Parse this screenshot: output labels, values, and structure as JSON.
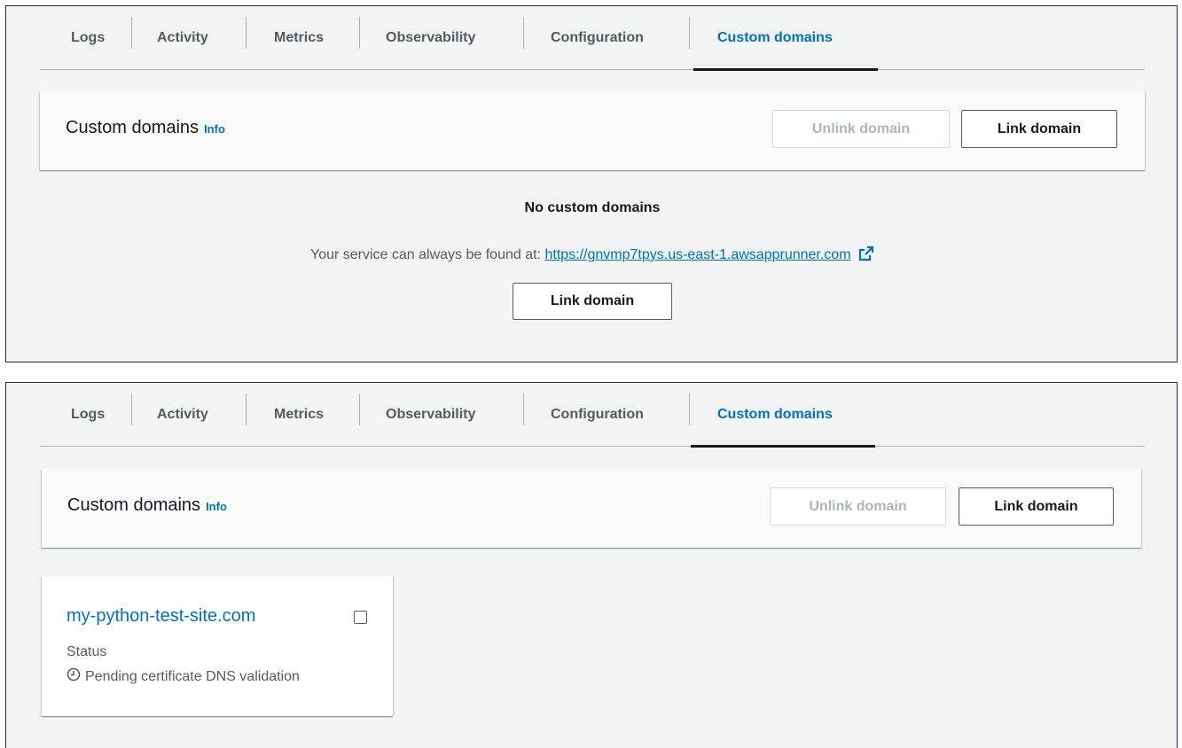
{
  "tabs": [
    "Logs",
    "Activity",
    "Metrics",
    "Observability",
    "Configuration",
    "Custom domains"
  ],
  "active_tab": "Custom domains",
  "header": {
    "title": "Custom domains",
    "info": "Info",
    "unlink_label": "Unlink domain",
    "link_label": "Link domain"
  },
  "empty_state": {
    "title": "No custom domains",
    "description": "Your service can always be found at:",
    "url": "https://gnvmp7tpys.us-east-1.awsapprunner.com",
    "link_label": "Link domain"
  },
  "domain": {
    "name": "my-python-test-site.com",
    "status_label": "Status",
    "status_value": "Pending certificate DNS validation",
    "status_icon": "clock-icon"
  },
  "colors": {
    "accent": "#0073bb",
    "panel_bg": "#f2f3f3",
    "disabled": "#aab7b8"
  }
}
